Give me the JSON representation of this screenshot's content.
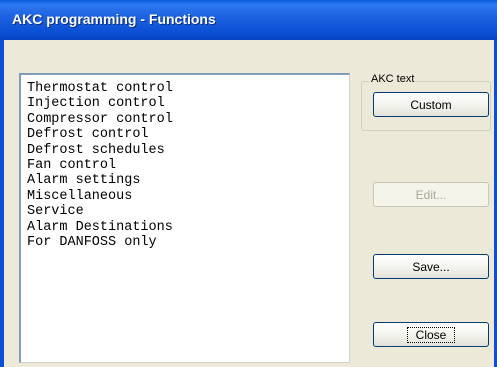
{
  "window": {
    "title": "AKC programming - Functions"
  },
  "functions_list": {
    "items": [
      "Thermostat control",
      "Injection control",
      "Compressor control",
      "Defrost control",
      "Defrost schedules",
      "Fan control",
      "Alarm settings",
      "Miscellaneous",
      "Service",
      "Alarm Destinations",
      "For DANFOSS only"
    ]
  },
  "akc_text_group": {
    "label": "AKC text",
    "custom_button": "Custom"
  },
  "buttons": {
    "edit": "Edit...",
    "save": "Save...",
    "close": "Close"
  },
  "colors": {
    "titlebar": "#0b4fd6",
    "dialog_background": "#ece9d8",
    "button_border": "#003c74",
    "disabled_text": "#aca899"
  }
}
